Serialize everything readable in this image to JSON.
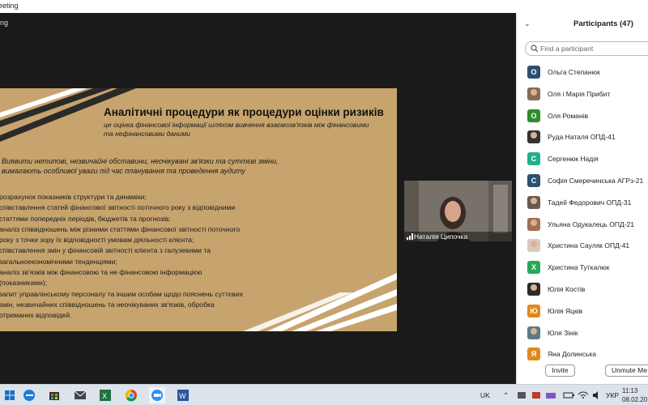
{
  "window": {
    "title": "eeting"
  },
  "meeting": {
    "label": "ing"
  },
  "slide": {
    "title": "Аналітичні процедури як процедури оцінки ризиків",
    "subtitle": "це оцінка фінансової інформації шляхом вивчення взаємозв'язків між фінансовими та нефінансовими даними",
    "intro": "Виявити нетипові, незвичайні обставини,  неочікувані зв'язки та суттєві зміни, вимагають особливої уваги під час планування та проведення аудиту",
    "lines": [
      "розрахунок показників структури та динаміки;",
      "співставлення статей фінансової звітності поточного року з відповідними",
      "статтями попередніх періодів, бюджетів та прогнозів;",
      "аналіз співвідношень між різними статтями фінансової звітності поточного",
      "року з точки зору їх відповідності умовам діяльності клієнта;",
      "співставлення змін у фінансовій звітності клієнта з галузевими та",
      "загальноекономічними тенденціями;",
      "аналіз зв'язків між фінансовою та не фінансовою інформацією",
      "(показниками);",
      "запит управлінському персоналу та іншим особам щодо пояснень суттєвих",
      "змін, незвичайних співвідношень та неочікуваних зв'язків, обробка",
      "отриманих відповідей."
    ]
  },
  "video": {
    "name": "Наталія Ципочка"
  },
  "participants": {
    "title": "Participants (47)",
    "search_placeholder": "Find a participant",
    "list": [
      {
        "name": "Ольга Степанюк",
        "initial": "O",
        "color": "#2e4f6f"
      },
      {
        "name": "Оля і Марія Прибит",
        "initial": "",
        "color": "#8a6a55"
      },
      {
        "name": "Оля Романів",
        "initial": "O",
        "color": "#2e8b2e"
      },
      {
        "name": "Руда Наталя ОПД-41",
        "initial": "",
        "color": "#333333"
      },
      {
        "name": "Сергенюк Надія",
        "initial": "C",
        "color": "#20b08a"
      },
      {
        "name": "Софія Смеречинська АГРз-21",
        "initial": "C",
        "color": "#2e4f6f"
      },
      {
        "name": "Тадей Федорович ОПД-31",
        "initial": "",
        "color": "#6b5a4a"
      },
      {
        "name": "Ульяна Одукалець ОПД-21",
        "initial": "",
        "color": "#a07050"
      },
      {
        "name": "Христина Сауляк ОПД-41",
        "initial": "",
        "color": "#d8c8c0"
      },
      {
        "name": "Христина Туткалюк",
        "initial": "X",
        "color": "#27a85a"
      },
      {
        "name": "Юлія Костів",
        "initial": "",
        "color": "#2b2b2b"
      },
      {
        "name": "Юлія Яцків",
        "initial": "Ю",
        "color": "#e08a1e"
      },
      {
        "name": "Юля Зінік",
        "initial": "",
        "color": "#5b7a88"
      },
      {
        "name": "Яна Долинська",
        "initial": "Я",
        "color": "#e08a1e"
      }
    ],
    "invite_label": "Invite",
    "unmute_label": "Unmute Me"
  },
  "taskbar": {
    "lang": "UK",
    "input_lang": "УКР",
    "time": "11:13",
    "date": "08.02.20"
  },
  "colors": {
    "slide_bg": "#c7a46d",
    "stripe": "#ffffff",
    "stripe_dark": "#2a2a2a"
  }
}
